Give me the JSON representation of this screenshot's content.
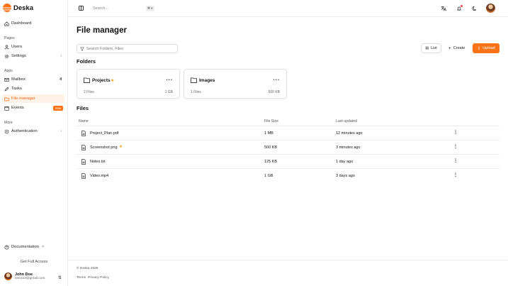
{
  "brand": {
    "name": "Deska",
    "color": "#f97316"
  },
  "sidebar": {
    "sections": {
      "pages": "Pages",
      "apps": "Apps",
      "more": "More"
    },
    "items": [
      {
        "label": "Dashboard",
        "icon": "home-icon"
      },
      {
        "label": "Users",
        "icon": "user-icon"
      },
      {
        "label": "Settings",
        "icon": "gear-icon"
      },
      {
        "label": "Mailbox",
        "icon": "mail-icon",
        "count": "4"
      },
      {
        "label": "Tasks",
        "icon": "pencil-icon"
      },
      {
        "label": "File manager",
        "icon": "folder-icon",
        "active": true
      },
      {
        "label": "Events",
        "icon": "calendar-icon",
        "badge": "new"
      },
      {
        "label": "Authentication",
        "icon": "lock-icon"
      }
    ],
    "documentation": "Documentation",
    "full_access": "Get Full Access",
    "user": {
      "name": "John Doe",
      "email": "test123@gmail.com"
    }
  },
  "topbar": {
    "search_placeholder": "Search...",
    "shortcut": "⌘ K"
  },
  "main": {
    "title": "File manager",
    "filter_placeholder": "Search Folders, Files",
    "buttons": {
      "list": "List",
      "create": "Create",
      "upload": "Upload"
    },
    "folders_title": "Folders",
    "folders": [
      {
        "name": "Projects",
        "starred": true,
        "count": "2 Files",
        "size": "1 GB"
      },
      {
        "name": "Images",
        "starred": false,
        "count": "1 Files",
        "size": "500 KB"
      }
    ],
    "files_title": "Files",
    "columns": {
      "name": "Name",
      "size": "File Size",
      "updated": "Last updated"
    },
    "files": [
      {
        "name": "Project_Plan.pdf",
        "size": "1 MB",
        "updated": "12 minutes ago",
        "starred": false
      },
      {
        "name": "Screenshot.png",
        "size": "500 KB",
        "updated": "3 minutes ago",
        "starred": true
      },
      {
        "name": "Notes.txt",
        "size": "125 KB",
        "updated": "1 day ago",
        "starred": false
      },
      {
        "name": "Video.mp4",
        "size": "1 GB",
        "updated": "3 days ago",
        "starred": false
      }
    ]
  },
  "footer": {
    "copyright": "© Deska 2026",
    "terms": "Terms",
    "privacy": "Privacy Policy"
  }
}
